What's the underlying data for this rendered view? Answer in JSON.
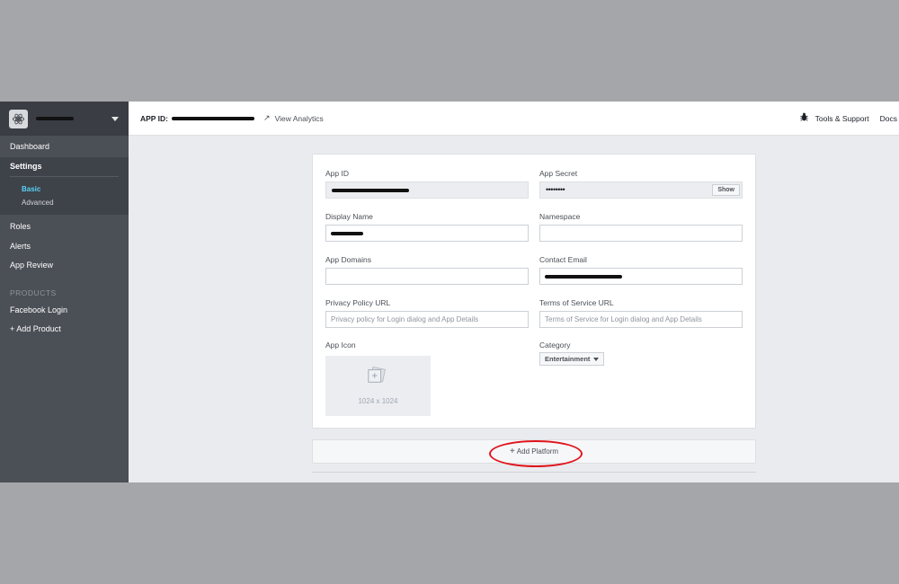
{
  "sidebar": {
    "items": [
      {
        "label": "Dashboard"
      },
      {
        "label": "Settings"
      },
      {
        "label": "Roles"
      },
      {
        "label": "Alerts"
      },
      {
        "label": "App Review"
      }
    ],
    "settings_sub": [
      {
        "label": "Basic",
        "active": true
      },
      {
        "label": "Advanced",
        "active": false
      }
    ],
    "products_label": "PRODUCTS",
    "products": [
      {
        "label": "Facebook Login"
      },
      {
        "label": "+ Add Product"
      }
    ]
  },
  "topbar": {
    "app_id_label": "APP ID:",
    "view_analytics": "View Analytics",
    "tools_support": "Tools & Support",
    "docs": "Docs"
  },
  "form": {
    "app_id_label": "App ID",
    "app_secret_label": "App Secret",
    "app_secret_value": "••••••••",
    "show_button": "Show",
    "display_name_label": "Display Name",
    "namespace_label": "Namespace",
    "app_domains_label": "App Domains",
    "contact_email_label": "Contact Email",
    "privacy_label": "Privacy Policy URL",
    "privacy_placeholder": "Privacy policy for Login dialog and App Details",
    "tos_label": "Terms of Service URL",
    "tos_placeholder": "Terms of Service for Login dialog and App Details",
    "app_icon_label": "App Icon",
    "app_icon_size": "1024 x 1024",
    "category_label": "Category",
    "category_value": "Entertainment"
  },
  "platform": {
    "add_label": "Add Platform"
  },
  "colors": {
    "sidebar_bg": "#4b4f56",
    "active_sub": "#58d2f4",
    "annotation": "#e0141c"
  }
}
